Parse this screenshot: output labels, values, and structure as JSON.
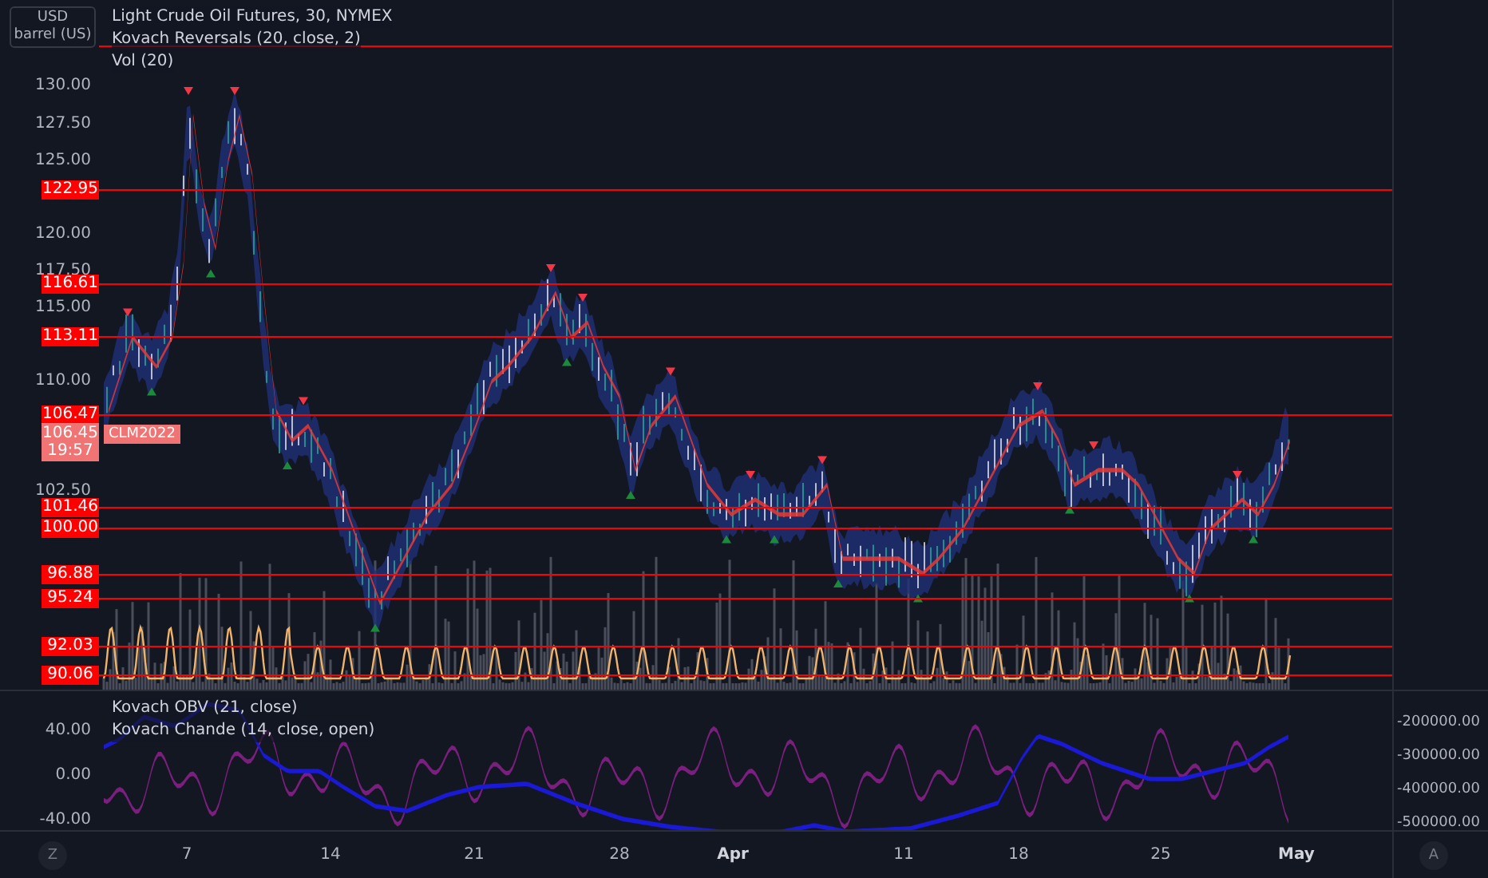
{
  "unit_box": {
    "currency": "USD",
    "unit": "barrel (US)"
  },
  "legend": [
    "Light Crude Oil Futures, 30, NYMEX",
    "Kovach Reversals (20, close, 2)",
    "Vol (20)"
  ],
  "price_axis": [
    {
      "label": "130.00",
      "kind": "tick"
    },
    {
      "label": "127.50",
      "kind": "tick"
    },
    {
      "label": "125.00",
      "kind": "tick"
    },
    {
      "label": "122.95",
      "kind": "level"
    },
    {
      "label": "120.00",
      "kind": "tick"
    },
    {
      "label": "117.50",
      "kind": "tick"
    },
    {
      "label": "116.61",
      "kind": "level"
    },
    {
      "label": "115.00",
      "kind": "tick"
    },
    {
      "label": "113.11",
      "kind": "level"
    },
    {
      "label": "110.00",
      "kind": "tick"
    },
    {
      "label": "106.47",
      "kind": "level"
    },
    {
      "label": "102.50",
      "kind": "tick"
    },
    {
      "label": "101.46",
      "kind": "level"
    },
    {
      "label": "100.00",
      "kind": "level"
    },
    {
      "label": "96.88",
      "kind": "level"
    },
    {
      "label": "95.24",
      "kind": "level"
    },
    {
      "label": "92.03",
      "kind": "level"
    },
    {
      "label": "90.06",
      "kind": "level"
    }
  ],
  "last_price": {
    "price": "106.45",
    "countdown": "19:57",
    "symbol": "CLM2022"
  },
  "lower_pane": {
    "legend": [
      "Kovach OBV (21, close)",
      "Kovach Chande (14, close, open)"
    ],
    "left_axis": [
      "40.00",
      "0.00",
      "-40.00"
    ],
    "right_axis": [
      "-200000.00",
      "-300000.00",
      "-400000.00",
      "-500000.00"
    ]
  },
  "time_axis": {
    "left_button": "Z",
    "right_button": "A",
    "labels": [
      {
        "label": "7",
        "kind": "day"
      },
      {
        "label": "14",
        "kind": "day"
      },
      {
        "label": "21",
        "kind": "day"
      },
      {
        "label": "28",
        "kind": "day"
      },
      {
        "label": "Apr",
        "kind": "month"
      },
      {
        "label": "11",
        "kind": "day"
      },
      {
        "label": "18",
        "kind": "day"
      },
      {
        "label": "25",
        "kind": "day"
      },
      {
        "label": "May",
        "kind": "month"
      }
    ]
  }
}
